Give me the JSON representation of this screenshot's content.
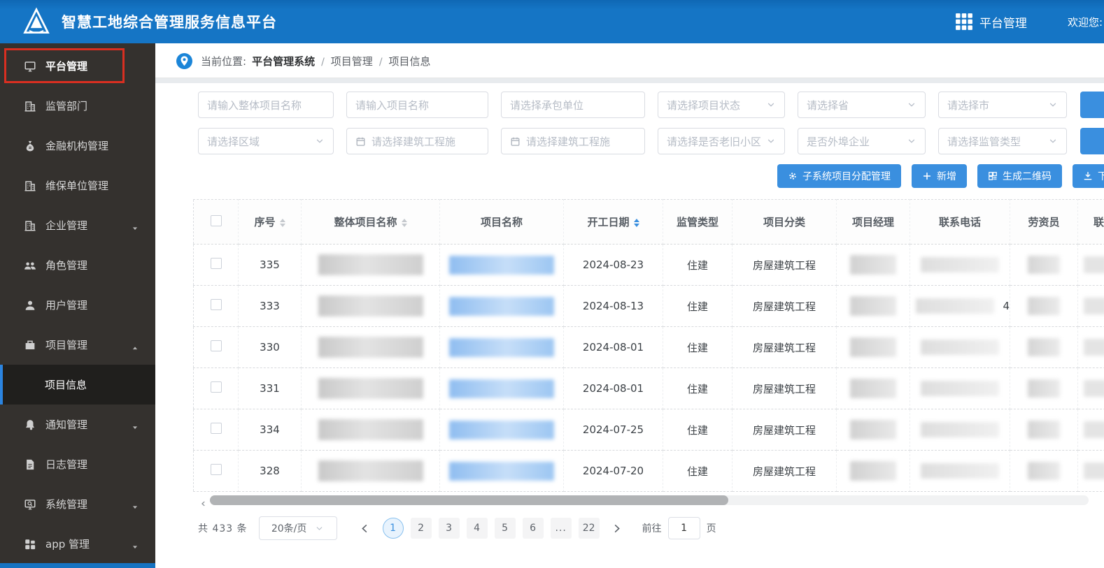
{
  "colors": {
    "header_blue": "#1575c5",
    "sidebar_bg": "#34312e",
    "accent_blue": "#3a8fdf",
    "highlight_red": "#d92f21",
    "link_blue": "#9cc6f2"
  },
  "header": {
    "title": "智慧工地综合管理服务信息平台",
    "nav": "平台管理",
    "welcome": "欢迎您:"
  },
  "sidebar": {
    "items": [
      {
        "id": "platform",
        "label": "平台管理",
        "icon": "monitor-icon",
        "highlight": true
      },
      {
        "id": "regulatory-dept",
        "label": "监管部门",
        "icon": "building-icon"
      },
      {
        "id": "financial-org",
        "label": "金融机构管理",
        "icon": "moneybag-icon"
      },
      {
        "id": "maintenance-unit",
        "label": "维保单位管理",
        "icon": "building-icon"
      },
      {
        "id": "enterprise",
        "label": "企业管理",
        "icon": "building-icon",
        "arrow": "down"
      },
      {
        "id": "role",
        "label": "角色管理",
        "icon": "team-icon"
      },
      {
        "id": "user",
        "label": "用户管理",
        "icon": "user-icon"
      },
      {
        "id": "project",
        "label": "项目管理",
        "icon": "project-icon",
        "arrow": "up"
      },
      {
        "id": "project-info",
        "label": "项目信息",
        "submenu": true,
        "active": true
      },
      {
        "id": "notice",
        "label": "通知管理",
        "icon": "bell-icon",
        "arrow": "down"
      },
      {
        "id": "log",
        "label": "日志管理",
        "icon": "log-icon"
      },
      {
        "id": "system",
        "label": "系统管理",
        "icon": "system-icon",
        "arrow": "down"
      },
      {
        "id": "app",
        "label": "app 管理",
        "icon": "app-grid-icon",
        "arrow": "down"
      }
    ]
  },
  "breadcrumb": {
    "prefix": "当前位置:",
    "items": [
      "平台管理系统",
      "项目管理",
      "项目信息"
    ]
  },
  "filters": {
    "row1": [
      {
        "id": "overall-project-name",
        "type": "input",
        "placeholder": "请输入整体项目名称"
      },
      {
        "id": "project-name",
        "type": "input",
        "placeholder": "请输入项目名称"
      },
      {
        "id": "contractor",
        "type": "input",
        "placeholder": "请选择承包单位"
      },
      {
        "id": "project-status",
        "type": "select",
        "placeholder": "请选择项目状态"
      },
      {
        "id": "province",
        "type": "select",
        "placeholder": "请选择省"
      },
      {
        "id": "city",
        "type": "select",
        "placeholder": "请选择市"
      }
    ],
    "row2": [
      {
        "id": "region",
        "type": "select",
        "placeholder": "请选择区域"
      },
      {
        "id": "construction-date-start",
        "type": "date",
        "placeholder": "请选择建筑工程施"
      },
      {
        "id": "construction-date-end",
        "type": "date",
        "placeholder": "请选择建筑工程施"
      },
      {
        "id": "old-community",
        "type": "select",
        "placeholder": "请选择是否老旧小区"
      },
      {
        "id": "external-enterprise",
        "type": "select",
        "placeholder": "是否外埠企业"
      },
      {
        "id": "supervision-type",
        "type": "select",
        "placeholder": "请选择监管类型"
      }
    ]
  },
  "actions": [
    {
      "id": "subsystem-assign",
      "label": "子系统项目分配管理",
      "icon": "gear-icon"
    },
    {
      "id": "add",
      "label": "新增",
      "icon": "plus-icon"
    },
    {
      "id": "generate-qrcode",
      "label": "生成二维码",
      "icon": "qrcode-icon"
    },
    {
      "id": "download",
      "label": "下载",
      "icon": "download-icon",
      "truncated": true
    }
  ],
  "table": {
    "columns": [
      {
        "id": "select",
        "label": "",
        "checkbox": true
      },
      {
        "id": "seq",
        "label": "序号",
        "sortable": true
      },
      {
        "id": "overall-name",
        "label": "整体项目名称",
        "sortable": true
      },
      {
        "id": "project-name",
        "label": "项目名称"
      },
      {
        "id": "start-date",
        "label": "开工日期",
        "sortable": true,
        "sort_active": true
      },
      {
        "id": "supervision-type",
        "label": "监管类型"
      },
      {
        "id": "project-category",
        "label": "项目分类"
      },
      {
        "id": "project-manager",
        "label": "项目经理"
      },
      {
        "id": "contact-phone",
        "label": "联系电话"
      },
      {
        "id": "labor-officer",
        "label": "劳资员"
      },
      {
        "id": "truncated",
        "label": "联"
      }
    ],
    "redacted_columns": [
      "整体项目名称",
      "项目名称",
      "项目经理",
      "联系电话",
      "劳资员"
    ],
    "rows": [
      {
        "seq": "335",
        "start_date": "2024-08-23",
        "supervision_type": "住建",
        "project_category": "房屋建筑工程"
      },
      {
        "seq": "333",
        "start_date": "2024-08-13",
        "supervision_type": "住建",
        "project_category": "房屋建筑工程",
        "phone_visible": "4"
      },
      {
        "seq": "330",
        "start_date": "2024-08-01",
        "supervision_type": "住建",
        "project_category": "房屋建筑工程"
      },
      {
        "seq": "331",
        "start_date": "2024-08-01",
        "supervision_type": "住建",
        "project_category": "房屋建筑工程"
      },
      {
        "seq": "334",
        "start_date": "2024-07-25",
        "supervision_type": "住建",
        "project_category": "房屋建筑工程"
      },
      {
        "seq": "328",
        "start_date": "2024-07-20",
        "supervision_type": "住建",
        "project_category": "房屋建筑工程"
      }
    ]
  },
  "pagination": {
    "total": "共 433 条",
    "page_size": "20条/页",
    "pages": [
      "1",
      "2",
      "3",
      "4",
      "5",
      "6",
      "...",
      "22"
    ],
    "active": "1",
    "goto_prefix": "前往",
    "goto_value": "1",
    "goto_suffix": "页"
  }
}
